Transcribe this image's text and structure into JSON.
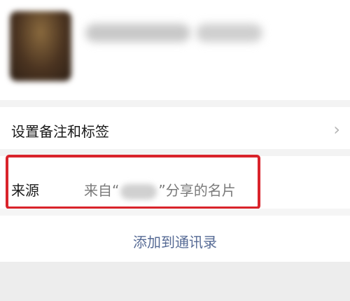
{
  "profile": {
    "avatar_icon": "avatar-blurred"
  },
  "settings_row": {
    "label": "设置备注和标签",
    "chevron": "›"
  },
  "source_row": {
    "label": "来源",
    "value_prefix": "来自“",
    "value_suffix": "”分享的名片"
  },
  "add_contact": {
    "label": "添加到通讯录"
  },
  "colors": {
    "highlight": "#d9232b",
    "link": "#576b95"
  }
}
